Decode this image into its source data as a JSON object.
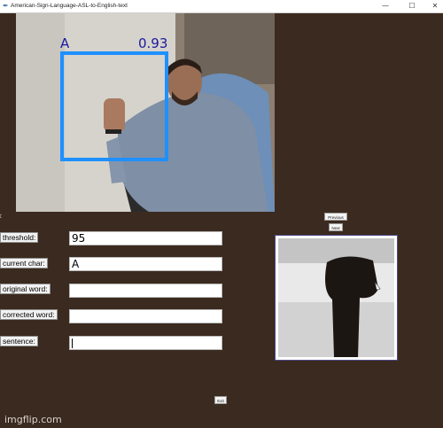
{
  "window": {
    "title": "American-Sign-Language-ASL-to-English-text",
    "minimize_icon": "—",
    "maximize_icon": "☐",
    "close_icon": "✕"
  },
  "camera": {
    "detected_label": "A",
    "confidence": "0.93",
    "box_color": "#1e90ff",
    "text_color": "#1a1aa0"
  },
  "nav": {
    "previous_label": "Previous",
    "next_label": "Next",
    "exit_label": "Exit"
  },
  "fields": {
    "threshold": {
      "label": "threshold:",
      "value": "95"
    },
    "current_char": {
      "label": "current char:",
      "value": "A"
    },
    "original_word": {
      "label": "original word:",
      "value": ""
    },
    "corrected_word": {
      "label": "corrected word:",
      "value": ""
    },
    "sentence": {
      "label": "sentence:",
      "value": ""
    }
  },
  "watermark": "imgflip.com",
  "colors": {
    "background": "#3b2a1f",
    "panel_border": "#4a4a8a"
  }
}
